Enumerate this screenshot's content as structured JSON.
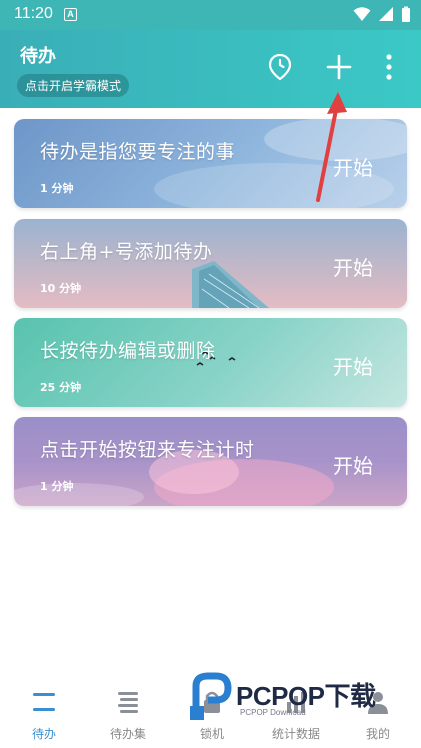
{
  "status_bar": {
    "time": "11:20",
    "sim_badge": "A"
  },
  "header": {
    "title": "待办",
    "mode_button": "点击开启学霸模式"
  },
  "cards": [
    {
      "title": "待办是指您要专注的事",
      "duration": "1 分钟",
      "action": "开始"
    },
    {
      "title": "右上角+号添加待办",
      "duration": "10 分钟",
      "action": "开始"
    },
    {
      "title": "长按待办编辑或删除",
      "duration": "25 分钟",
      "action": "开始"
    },
    {
      "title": "点击开始按钮来专注计时",
      "duration": "1 分钟",
      "action": "开始"
    }
  ],
  "tabs": [
    {
      "label": "待办",
      "icon": "todo-list-icon",
      "active": true
    },
    {
      "label": "待办集",
      "icon": "todo-collection-icon",
      "active": false
    },
    {
      "label": "锁机",
      "icon": "lock-icon",
      "active": false
    },
    {
      "label": "统计数据",
      "icon": "stats-icon",
      "active": false
    },
    {
      "label": "我的",
      "icon": "profile-icon",
      "active": false
    }
  ],
  "watermark": {
    "brand": "PCPOP下载",
    "sub": "PCPOP Download"
  },
  "colors": {
    "header_start": "#3aaeb7",
    "header_end": "#3bc9c6",
    "tab_active": "#3a8fd0",
    "arrow": "#e04040"
  }
}
